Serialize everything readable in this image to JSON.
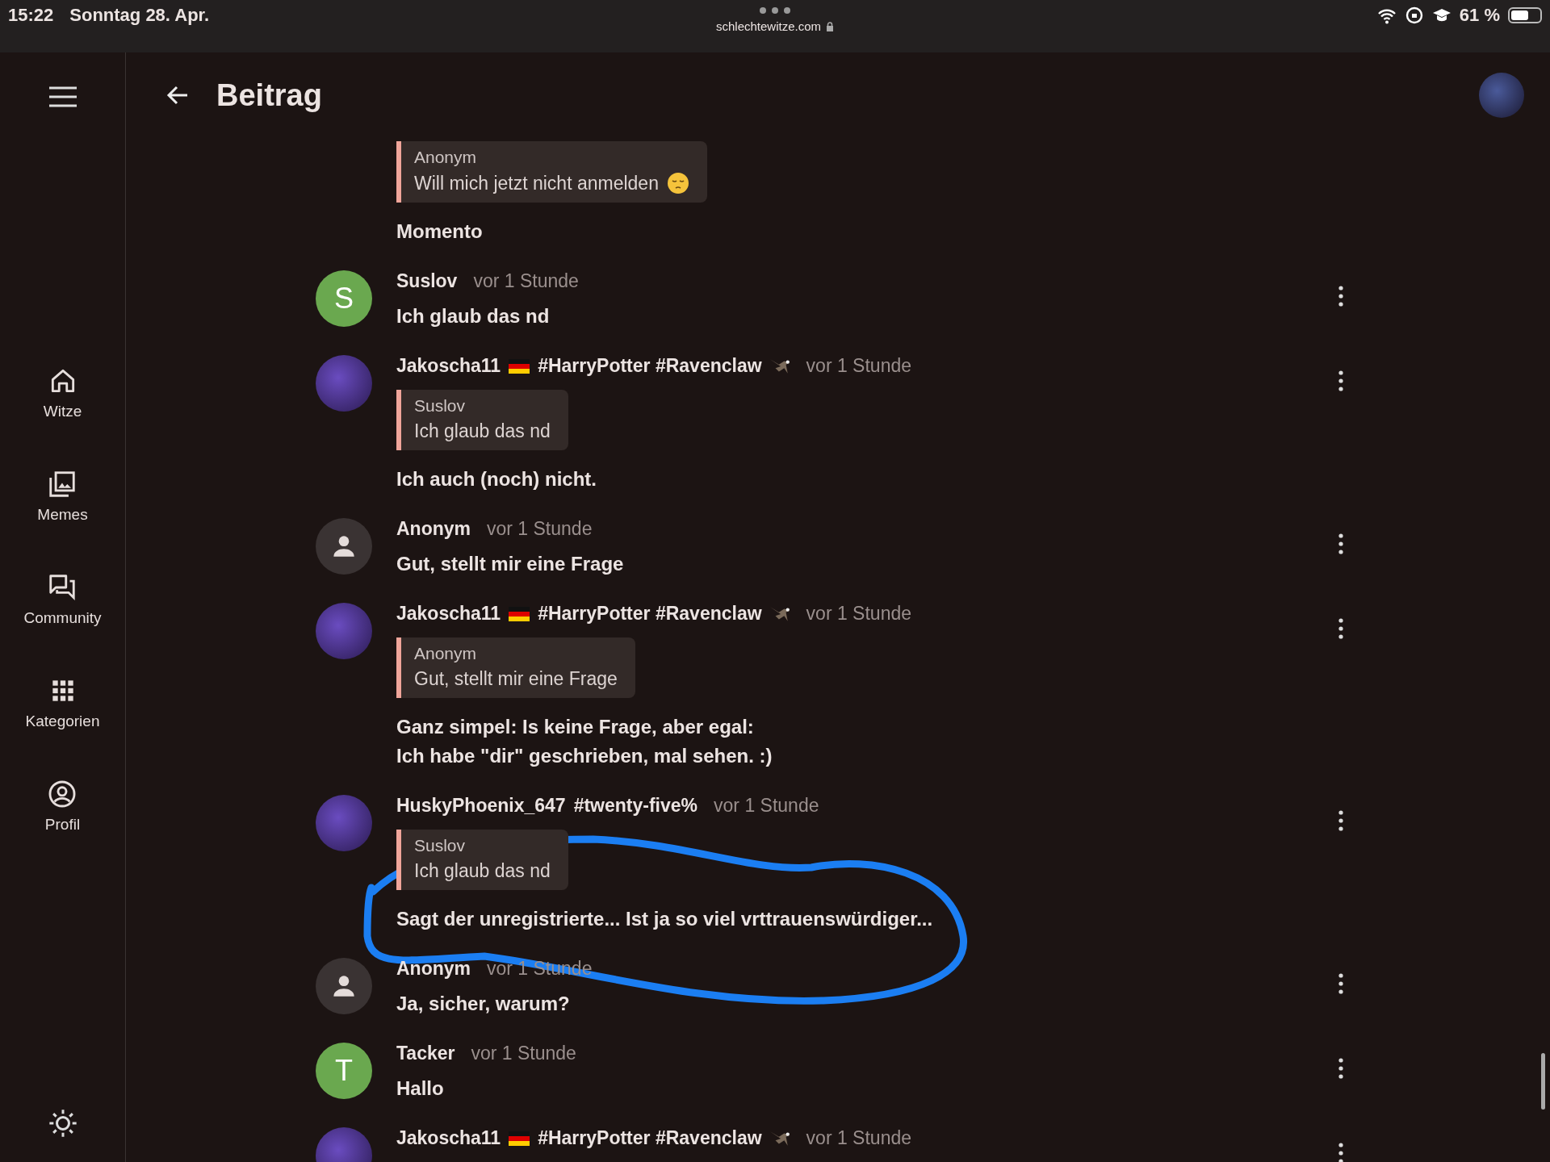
{
  "status_bar": {
    "time": "15:22",
    "date": "Sonntag 28. Apr.",
    "url": "schlechtewitze.com",
    "battery": "61 %"
  },
  "sidebar": {
    "items": [
      {
        "label": "Witze",
        "kind": "home",
        "selected": false
      },
      {
        "label": "Memes",
        "kind": "images",
        "selected": false
      },
      {
        "label": "Community",
        "kind": "chat",
        "selected": false
      },
      {
        "label": "Kategorien",
        "kind": "grid",
        "selected": false
      },
      {
        "label": "Profil",
        "kind": "account",
        "selected": false
      }
    ]
  },
  "header": {
    "title": "Beitrag"
  },
  "comments": [
    {
      "kind": "partial",
      "quote": {
        "author": "Anonym",
        "text": "Will mich jetzt nicht anmelden",
        "emoji": true
      },
      "text": [
        "Momento"
      ]
    },
    {
      "kind": "letter",
      "letter": "S",
      "color": "#6aa84f",
      "author": "Suslov",
      "time": "vor 1 Stunde",
      "text": [
        "Ich glaub das nd"
      ]
    },
    {
      "kind": "picture",
      "author": "Jakoscha11",
      "emblems": true,
      "tags": "#HarryPotter #Ravenclaw",
      "time": "vor 1 Stunde",
      "quote": {
        "author": "Suslov",
        "text": "Ich glaub das nd"
      },
      "text": [
        "Ich auch (noch) nicht."
      ]
    },
    {
      "kind": "person",
      "author": "Anonym",
      "time": "vor 1 Stunde",
      "text": [
        "Gut, stellt mir eine Frage"
      ]
    },
    {
      "kind": "picture",
      "author": "Jakoscha11",
      "emblems": true,
      "tags": "#HarryPotter #Ravenclaw",
      "time": "vor 1 Stunde",
      "quote": {
        "author": "Anonym",
        "text": "Gut, stellt mir eine Frage"
      },
      "text": [
        "Ganz simpel: Is keine Frage, aber egal:",
        "Ich habe \"dir\" geschrieben, mal sehen. :)"
      ]
    },
    {
      "kind": "picture",
      "author": "HuskyPhoenix_647",
      "tags": "#twenty-five%",
      "time": "vor 1 Stunde",
      "quote": {
        "author": "Suslov",
        "text": "Ich glaub das nd"
      },
      "text": [
        "Sagt der unregistrierte... Ist ja so viel vrttrauenswürdiger..."
      ]
    },
    {
      "kind": "person",
      "author": "Anonym",
      "time": "vor 1 Stunde",
      "text": [
        "Ja, sicher, warum?"
      ]
    },
    {
      "kind": "letter",
      "letter": "T",
      "color": "#6aa84f",
      "author": "Tacker",
      "time": "vor 1 Stunde",
      "text": [
        "Hallo"
      ]
    },
    {
      "kind": "picture",
      "author": "Jakoscha11",
      "emblems": true,
      "tags": "#HarryPotter #Ravenclaw",
      "time": "vor 1 Stunde"
    }
  ]
}
